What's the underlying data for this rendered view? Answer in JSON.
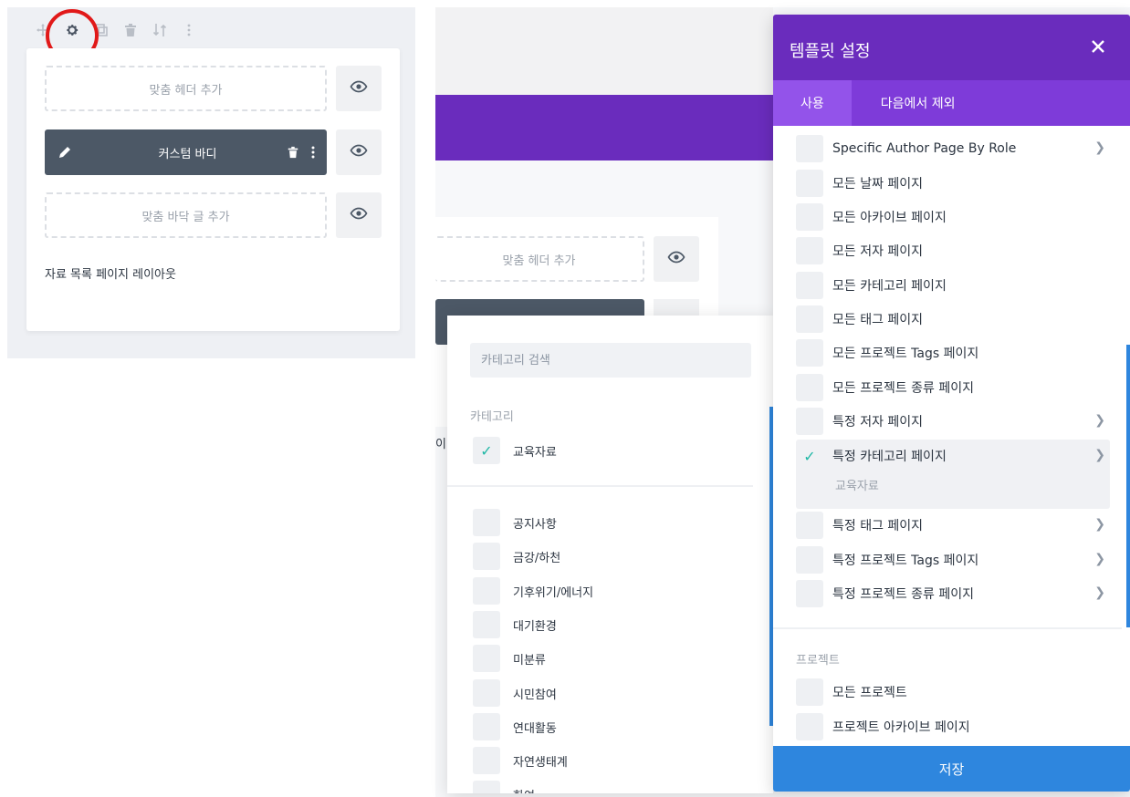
{
  "left_panel": {
    "header_slot_label": "맞춤 헤더 추가",
    "body_slot_label": "커스텀 바디",
    "footer_slot_label": "맞춤 바닥 글 추가",
    "layout_name": "자료 목록 페이지 레이아웃"
  },
  "middle": {
    "header_slot_label": "맞춤 헤더 추가",
    "partial_text": "이"
  },
  "category_dropdown": {
    "search_placeholder": "카테고리 검색",
    "section_header": "카테고리",
    "selected": [
      {
        "label": "교육자료",
        "checked": true
      }
    ],
    "items": [
      {
        "label": "공지사항",
        "checked": false
      },
      {
        "label": "금강/하천",
        "checked": false
      },
      {
        "label": "기후위기/에너지",
        "checked": false
      },
      {
        "label": "대기환경",
        "checked": false
      },
      {
        "label": "미분류",
        "checked": false
      },
      {
        "label": "시민참여",
        "checked": false
      },
      {
        "label": "연대활동",
        "checked": false
      },
      {
        "label": "자연생태계",
        "checked": false
      },
      {
        "label": "한여",
        "checked": false
      }
    ]
  },
  "template_settings": {
    "title": "템플릿 설정",
    "tabs": [
      "사용",
      "다음에서 제외"
    ],
    "items": [
      {
        "label": "Specific Author Page By Role",
        "checked": false,
        "has_submenu": true
      },
      {
        "label": "모든 날짜 페이지",
        "checked": false,
        "has_submenu": false
      },
      {
        "label": "모든 아카이브 페이지",
        "checked": false,
        "has_submenu": false
      },
      {
        "label": "모든 저자 페이지",
        "checked": false,
        "has_submenu": false
      },
      {
        "label": "모든 카테고리 페이지",
        "checked": false,
        "has_submenu": false
      },
      {
        "label": "모든 태그 페이지",
        "checked": false,
        "has_submenu": false
      },
      {
        "label": "모든 프로젝트 Tags 페이지",
        "checked": false,
        "has_submenu": false
      },
      {
        "label": "모든 프로젝트 종류 페이지",
        "checked": false,
        "has_submenu": false
      },
      {
        "label": "특정 저자 페이지",
        "checked": false,
        "has_submenu": true
      },
      {
        "label": "특정 카테고리 페이지",
        "checked": true,
        "has_submenu": true,
        "sub_label": "교육자료"
      },
      {
        "label": "특정 태그 페이지",
        "checked": false,
        "has_submenu": true
      },
      {
        "label": "특정 프로젝트 Tags 페이지",
        "checked": false,
        "has_submenu": true
      },
      {
        "label": "특정 프로젝트 종류 페이지",
        "checked": false,
        "has_submenu": true
      }
    ],
    "group_label": "프로젝트",
    "group_items": [
      {
        "label": "모든 프로젝트",
        "checked": false
      },
      {
        "label": "프로젝트 아카이브 페이지",
        "checked": false
      }
    ],
    "save_label": "저장"
  },
  "colors": {
    "purple_header": "#6a2cbd",
    "purple_tabs": "#7e3bd9",
    "save_blue": "#2e86de",
    "check_teal": "#21b8a6",
    "annotation_red": "#e11919"
  }
}
